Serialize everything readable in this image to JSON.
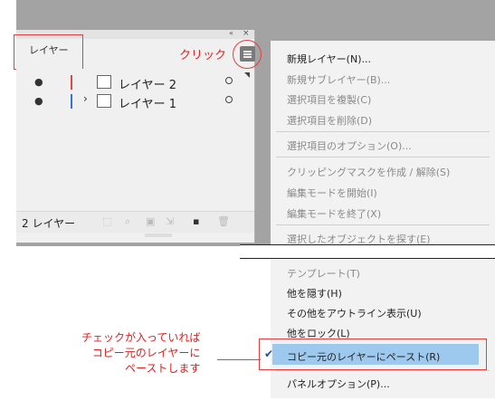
{
  "panel": {
    "tab_label": "レイヤー",
    "collapse_glyph": "«",
    "close_glyph": "×",
    "layers": [
      {
        "name": "レイヤー 2",
        "color": "#e04848",
        "expandable": false
      },
      {
        "name": "レイヤー 1",
        "color": "#3b6fd4",
        "expandable": true
      }
    ],
    "footer_count": "2 レイヤー"
  },
  "annotations": {
    "click_label": "クリック",
    "note_lines": [
      "チェックが入っていれば",
      "コピー元のレイヤーに",
      "ペーストします"
    ]
  },
  "menu": {
    "items": [
      {
        "label": "新規レイヤー(N)...",
        "enabled": true
      },
      {
        "label": "新規サブレイヤー(B)...",
        "enabled": false
      },
      {
        "label": "選択項目を複製(C)",
        "enabled": false
      },
      {
        "label": "選択項目を削除(D)",
        "enabled": false
      },
      {
        "label": "選択項目のオプション(O)...",
        "enabled": false
      },
      {
        "label": "クリッピングマスクを作成 / 解除(S)",
        "enabled": false
      },
      {
        "label": "編集モードを開始(I)",
        "enabled": false
      },
      {
        "label": "編集モードを終了(X)",
        "enabled": false
      },
      {
        "label": "選択したオブジェクトを探す(E)",
        "enabled": false
      },
      {
        "label": "テンプレート(T)",
        "enabled": false
      },
      {
        "label": "他を隠す(H)",
        "enabled": true
      },
      {
        "label": "その他をアウトライン表示(U)",
        "enabled": true
      },
      {
        "label": "他をロック(L)",
        "enabled": true
      },
      {
        "label": "コピー元のレイヤーにペースト(R)",
        "enabled": true,
        "checked": true
      },
      {
        "label": "パネルオプション(P)...",
        "enabled": true
      }
    ],
    "selected_color": "#9ec9ef"
  },
  "colors": {
    "highlight": "#e04040"
  }
}
